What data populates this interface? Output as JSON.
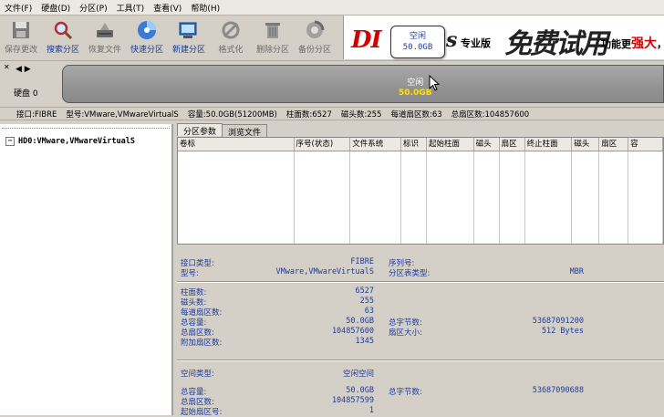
{
  "menu": [
    "文件(F)",
    "硬盘(D)",
    "分区(P)",
    "工具(T)",
    "查看(V)",
    "帮助(H)"
  ],
  "toolbar": [
    {
      "label": "保存更改",
      "icon": "save-disk-icon",
      "dim": true
    },
    {
      "label": "搜索分区",
      "icon": "search-icon",
      "dim": false
    },
    {
      "label": "恢复文件",
      "icon": "recover-file-icon",
      "dim": true
    },
    {
      "label": "快速分区",
      "icon": "quick-partition-icon",
      "dim": false
    },
    {
      "label": "新建分区",
      "icon": "new-partition-icon",
      "dim": false
    },
    {
      "label": "格式化",
      "icon": "format-icon",
      "dim": true
    },
    {
      "label": "删除分区",
      "icon": "delete-icon",
      "dim": true
    },
    {
      "label": "备份分区",
      "icon": "backup-icon",
      "dim": true
    }
  ],
  "banner": {
    "brand": "DI",
    "brand_tail": "us",
    "edition": "专业版",
    "free": "免费试用",
    "slogan_pre": "功能更",
    "slogan_red": "强大",
    "slogan_post": "，既"
  },
  "disk_map": {
    "disk_label": "硬盘 0",
    "free_label": "空闲",
    "free_size": "50.0GB",
    "tooltip_title": "空闲",
    "tooltip_size": "50.0GB"
  },
  "info_line": {
    "interface": "接口:FIBRE",
    "model": "型号:VMware,VMwareVirtualS",
    "capacity": "容量:50.0GB(51200MB)",
    "cylinders": "柱面数:6527",
    "heads": "磁头数:255",
    "sectors_per_track": "每道扇区数:63",
    "total_sectors": "总扇区数:104857600"
  },
  "tree": {
    "node": "HD0:VMware,VMwareVirtualS"
  },
  "tabs": [
    "分区参数",
    "浏览文件"
  ],
  "table_headers": [
    "卷标",
    "序号(状态)",
    "文件系统",
    "标识",
    "起始柱面",
    "磁头",
    "扇区",
    "终止柱面",
    "磁头",
    "扇区",
    "容"
  ],
  "details": {
    "interface_type_label": "接口类型:",
    "interface_type_value": "FIBRE",
    "model_label": "型号:",
    "model_value": "VMware,VMwareVirtualS",
    "serial_label": "序列号:",
    "serial_value": "",
    "table_type_label": "分区表类型:",
    "table_type_value": "MBR",
    "cylinders_label": "柱面数:",
    "cylinders_value": "6527",
    "heads_label": "磁头数:",
    "heads_value": "255",
    "spt_label": "每道扇区数:",
    "spt_value": "63",
    "capacity_label": "总容量:",
    "capacity_value": "50.0GB",
    "total_bytes_label": "总字节数:",
    "total_bytes_value": "53687091200",
    "total_sectors_label": "总扇区数:",
    "total_sectors_value": "104857600",
    "sector_size_label": "扇区大小:",
    "sector_size_value": "512 Bytes",
    "extra_sectors_label": "附加扇区数:",
    "extra_sectors_value": "1345",
    "space_type_label": "空间类型:",
    "space_type_value": "空闲空间",
    "free_capacity_label": "总容量:",
    "free_capacity_value": "50.0GB",
    "free_bytes_label": "总字节数:",
    "free_bytes_value": "53687090688",
    "free_sectors_label": "总扇区数:",
    "free_sectors_value": "104857599",
    "start_sector_label": "起始扇区号:",
    "start_sector_value": "1"
  }
}
